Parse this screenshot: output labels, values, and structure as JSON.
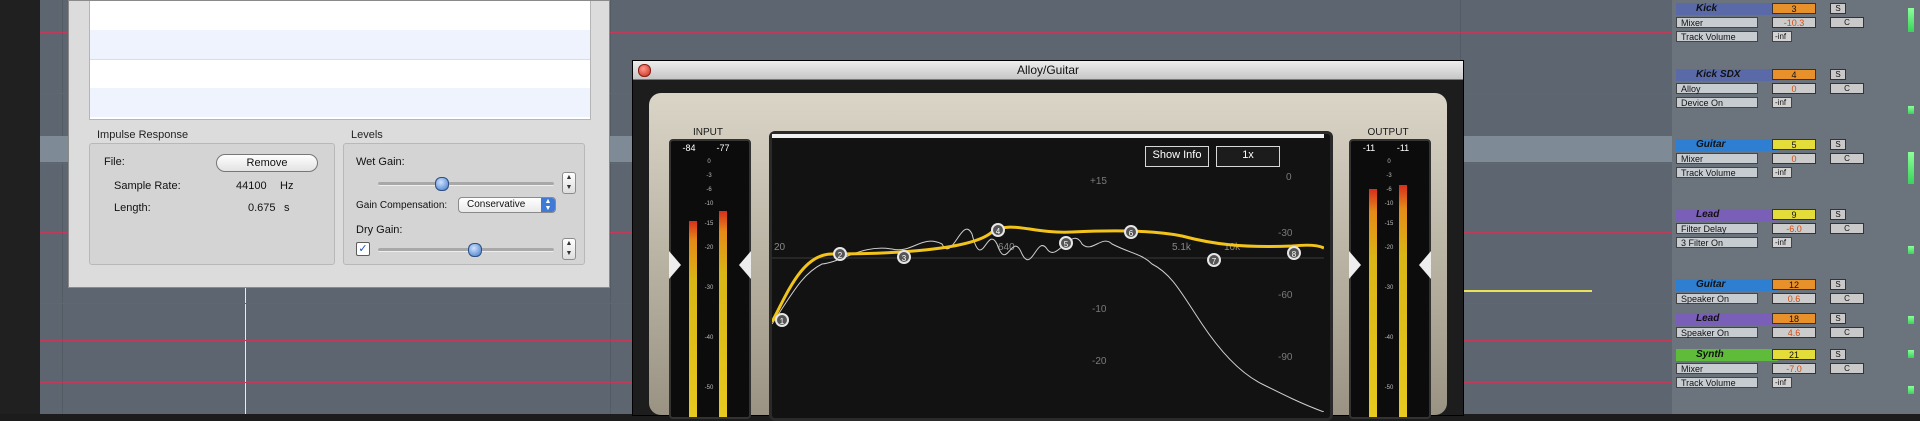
{
  "impulse_panel": {
    "section_title": "Impulse Response",
    "file_label": "File:",
    "remove_button": "Remove",
    "sample_rate_label": "Sample Rate:",
    "sample_rate_value": "44100",
    "sample_rate_unit": "Hz",
    "length_label": "Length:",
    "length_value": "0.675",
    "length_unit": "s"
  },
  "levels_panel": {
    "section_title": "Levels",
    "wet_gain_label": "Wet Gain:",
    "wet_gain_position": 0.35,
    "gain_comp_label": "Gain Compensation:",
    "gain_comp_value": "Conservative",
    "dry_gain_label": "Dry Gain:",
    "dry_gain_checked": true,
    "dry_gain_position": 0.55
  },
  "plugin": {
    "title": "Alloy/Guitar",
    "input_label": "INPUT",
    "output_label": "OUTPUT",
    "input_values": [
      "-84",
      "-77"
    ],
    "output_values": [
      "-11",
      "-11"
    ],
    "meter_scale": [
      "0",
      "-3",
      "-6",
      "-10",
      "-15",
      "-20",
      "-30",
      "-40",
      "-50"
    ],
    "show_info_button": "Show Info",
    "zoom_button": "1x",
    "db_labels_left": [
      "+15",
      "-10",
      "-20"
    ],
    "db_labels_right": [
      "0",
      "-30",
      "-60",
      "-90"
    ],
    "freq_labels": [
      "20",
      "640",
      "5.1k",
      "10k"
    ],
    "band_nodes": [
      "1",
      "2",
      "3",
      "4",
      "5",
      "6",
      "7",
      "8"
    ],
    "eq_curve_color": "#f2c31b"
  },
  "mixer": {
    "tracks": [
      {
        "name": "Kick",
        "color": "#5a6aa8",
        "device": "Mixer",
        "param": "Track Volume",
        "number": "3",
        "number_color": "#e8912a",
        "value": "-10.3",
        "pan": "C",
        "inf": "-inf"
      },
      {
        "name": "Kick SDX",
        "color": "#5a6aa8",
        "device": "Alloy",
        "param": "Device On",
        "number": "4",
        "number_color": "#e8912a",
        "value": "0",
        "pan": "C",
        "inf": "-inf"
      },
      {
        "name": "Guitar",
        "color": "#2e7fd1",
        "device": "Mixer",
        "param": "Track Volume",
        "number": "5",
        "number_color": "#e4dd39",
        "value": "0",
        "pan": "C",
        "inf": "-inf"
      },
      {
        "name": "Lead",
        "color": "#7a5fb8",
        "device": "Filter Delay",
        "param": "3 Filter On",
        "number": "9",
        "number_color": "#e4dd39",
        "value": "-6.0",
        "pan": "C",
        "inf": "-inf"
      },
      {
        "name": "Guitar",
        "color": "#2e7fd1",
        "device": "Speaker On",
        "number": "12",
        "number_color": "#e8912a",
        "value": "0.6",
        "pan": "C"
      },
      {
        "name": "Lead",
        "color": "#7a5fb8",
        "device": "Speaker On",
        "number": "18",
        "number_color": "#e8912a",
        "value": "4.6",
        "pan": "C"
      },
      {
        "name": "Synth",
        "color": "#5fbb3a",
        "device": "Mixer",
        "param": "Track Volume",
        "number": "21",
        "number_color": "#e4dd39",
        "value": "-7.0",
        "pan": "C",
        "inf": "-inf"
      }
    ],
    "s_label": "S"
  }
}
